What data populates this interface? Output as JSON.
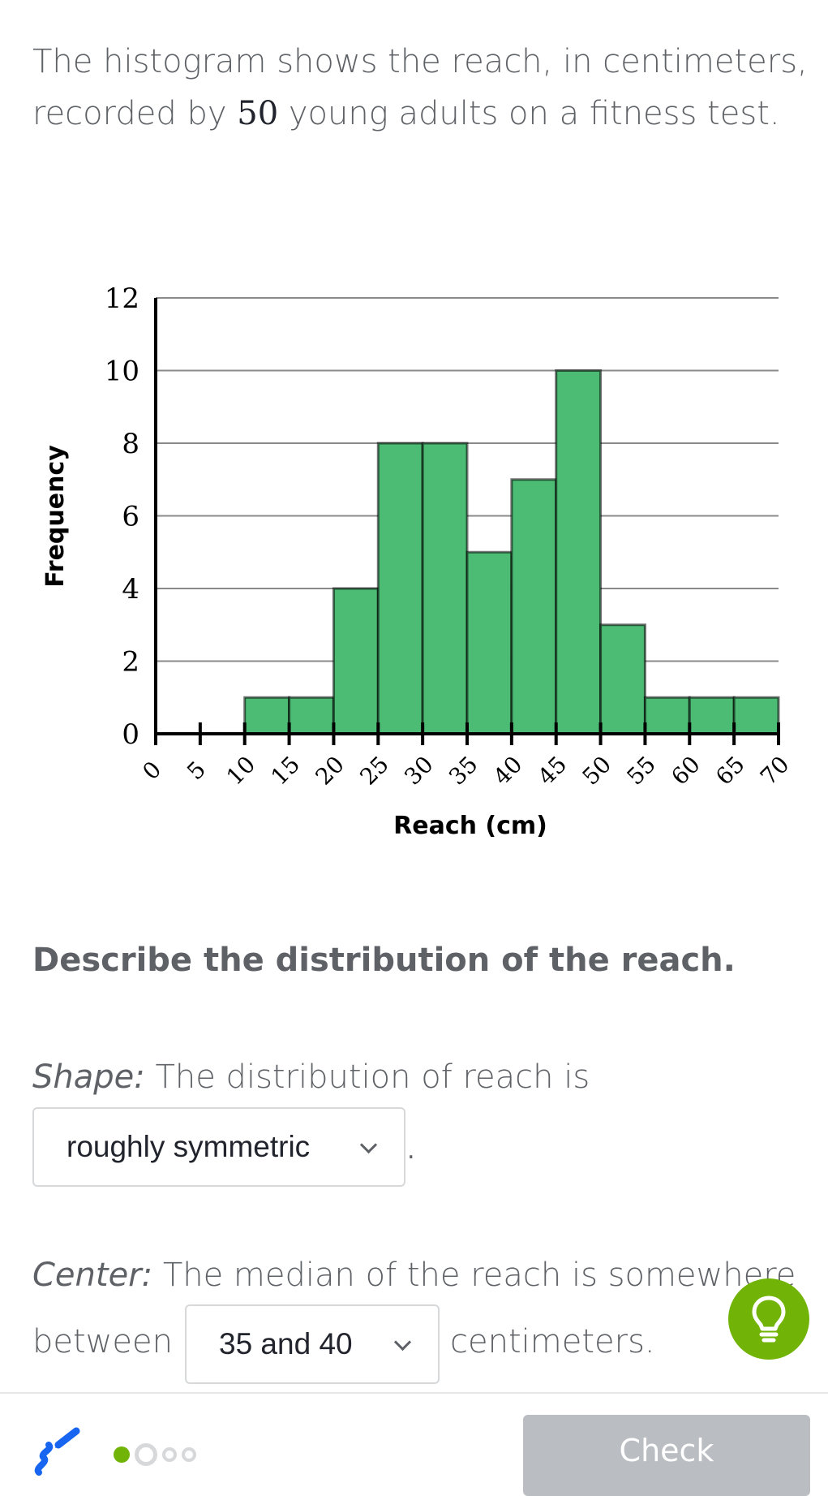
{
  "intro": {
    "part1": "The histogram shows the reach, in centimeters, recorded by ",
    "count": "50",
    "part2": " young adults on a fitness test."
  },
  "chart_data": {
    "type": "bar",
    "subtype": "histogram",
    "title": "",
    "xlabel": "Reach (cm)",
    "ylabel": "Frequency",
    "bin_edges": [
      10,
      15,
      20,
      25,
      30,
      35,
      40,
      45,
      50,
      55,
      60,
      65,
      70
    ],
    "categories": [
      "10-15",
      "15-20",
      "20-25",
      "25-30",
      "30-35",
      "35-40",
      "40-45",
      "45-50",
      "50-55",
      "55-60",
      "60-65",
      "65-70"
    ],
    "values": [
      1,
      1,
      4,
      8,
      8,
      5,
      7,
      10,
      3,
      1,
      1,
      1
    ],
    "xlim": [
      0,
      70
    ],
    "ylim": [
      0,
      12
    ],
    "x_ticks": [
      "0",
      "5",
      "10",
      "15",
      "20",
      "25",
      "30",
      "35",
      "40",
      "45",
      "50",
      "55",
      "60",
      "65",
      "70"
    ],
    "y_ticks": [
      "0",
      "2",
      "4",
      "6",
      "8",
      "10",
      "12"
    ],
    "grid": true,
    "bar_color": "#4cbb74",
    "legend": "none"
  },
  "prompt": "Describe the distribution of the reach.",
  "shape": {
    "label": "Shape:",
    "text": " The distribution of reach is",
    "selected": "roughly symmetric",
    "suffix": "."
  },
  "center": {
    "label": "Center:",
    "text": " The median of the reach is somewhere",
    "between": "between",
    "selected": "35 and 40",
    "suffix": "centimeters."
  },
  "footer": {
    "check_label": "Check",
    "progress": {
      "current": 1,
      "total": 4
    }
  },
  "colors": {
    "accent_green": "#71b307",
    "scratchpad_blue": "#1865f2",
    "check_disabled": "#babec2"
  }
}
